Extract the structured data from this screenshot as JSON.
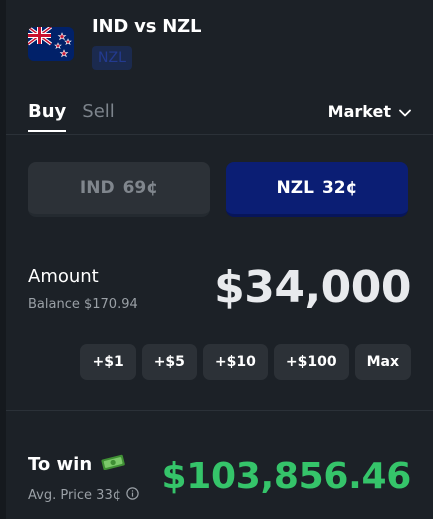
{
  "header": {
    "title": "IND vs NZL",
    "outcome_badge": "NZL",
    "flag_icon": "new-zealand-flag-icon"
  },
  "tabs": [
    {
      "label": "Buy",
      "active": true
    },
    {
      "label": "Sell",
      "active": false
    }
  ],
  "order_type": {
    "label": "Market",
    "icon": "chevron-down-icon"
  },
  "outcomes": [
    {
      "name": "IND",
      "price": "69¢",
      "selected": false
    },
    {
      "name": "NZL",
      "price": "32¢",
      "selected": true
    }
  ],
  "amount": {
    "label": "Amount",
    "balance": "Balance $170.94",
    "value": "$34,000"
  },
  "quick_add": [
    "+$1",
    "+$5",
    "+$10",
    "+$100",
    "Max"
  ],
  "to_win": {
    "label": "To win",
    "icon": "money-icon",
    "avg_price": "Avg. Price 33¢",
    "info_icon": "info-icon",
    "value": "$103,856.46"
  },
  "colors": {
    "background": "#1c2127",
    "selected_outcome": "#0b1e74",
    "win_green": "#35c46a"
  }
}
